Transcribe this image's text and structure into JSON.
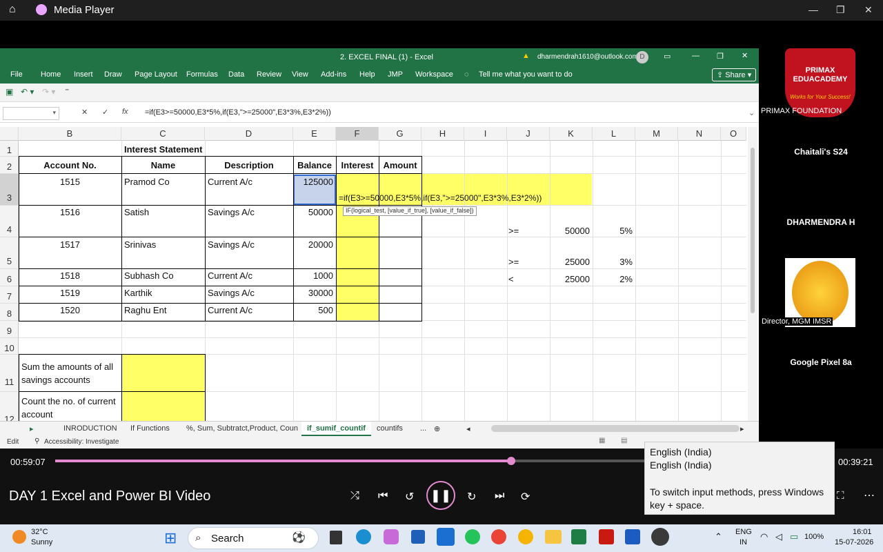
{
  "player": {
    "title": "Media Player",
    "video_title": "DAY 1 Excel and Power BI  Video",
    "time_elapsed": "00:59:07",
    "time_remaining": "00:39:21",
    "progress": 0.585
  },
  "excel": {
    "window_title": "2. EXCEL FINAL (1) - Excel",
    "account": "dharmendrah1610@outlook.com",
    "avatar_letter": "D",
    "share_label": "Share",
    "menu": [
      "File",
      "Home",
      "Insert",
      "Draw",
      "Page Layout",
      "Formulas",
      "Data",
      "Review",
      "View",
      "Add-ins",
      "Help",
      "JMP",
      "Workspace"
    ],
    "tell_me": "Tell me what you want to do",
    "formula_bar": "=if(E3>=50000,E3*5%,if(E3,\">=25000\",E3*3%,E3*2%))",
    "fx_label": "fx",
    "columns": [
      "B",
      "C",
      "D",
      "E",
      "F",
      "G",
      "H",
      "I",
      "J",
      "K",
      "L",
      "M",
      "N",
      "O"
    ],
    "rows": [
      "1",
      "2",
      "3",
      "4",
      "5",
      "6",
      "7",
      "8",
      "9",
      "10",
      "11",
      "12"
    ],
    "sheet_title": "Interest Statement",
    "headers": {
      "account": "Account No.",
      "name": "Name",
      "desc": "Description",
      "balance": "Balance",
      "interest": "Interest",
      "amount": "Amount"
    },
    "records": [
      {
        "acc": "1515",
        "name": "Pramod Co",
        "desc": "Current A/c",
        "bal": "125000"
      },
      {
        "acc": "1516",
        "name": "Satish",
        "desc": "Savings A/c",
        "bal": "50000"
      },
      {
        "acc": "1517",
        "name": "Srinivas",
        "desc": "Savings A/c",
        "bal": "20000"
      },
      {
        "acc": "1518",
        "name": "Subhash Co",
        "desc": "Current A/c",
        "bal": "1000"
      },
      {
        "acc": "1519",
        "name": "Karthik",
        "desc": "Savings A/c",
        "bal": "30000"
      },
      {
        "acc": "1520",
        "name": "Raghu Ent",
        "desc": "Current A/c",
        "bal": "500"
      }
    ],
    "cell_formula": "=if(E3>=50000,E3*5%,if(E3,\">=25000\",E3*3%,E3*2%))",
    "tooltip": "IF(logical_test, [value_if_true], [value_if_false])",
    "criteria": [
      {
        "op": ">=",
        "val": "50000",
        "pct": "5%"
      },
      {
        "op": ">=",
        "val": "25000",
        "pct": "3%"
      },
      {
        "op": "<",
        "val": "25000",
        "pct": "2%"
      }
    ],
    "q1": "Sum the amounts of all savings accounts",
    "q2": "Count the no. of current account",
    "tabs": [
      "INRODUCTION",
      "If Functions",
      "%, Sum, Subtratct,Product, Coun",
      "if_sumif_countif",
      "countifs",
      "..."
    ],
    "status_mode": "Edit",
    "accessibility": "Accessibility: Investigate"
  },
  "side": {
    "org_logo_text": "PRIMAX EDUACADEMY",
    "org_tagline": "Works for Your Success!",
    "org": "PRIMAX FOUNDATION",
    "p1": "Chaitali's S24",
    "p2": "DHARMENDRA H",
    "p3": "Director, MGM IMSR",
    "p4": "Google Pixel 8a"
  },
  "popup": {
    "line1": "English (India)",
    "line2": "English (India)",
    "hint": "To switch input methods, press Windows key + space."
  },
  "taskbar": {
    "temp": "32°C",
    "weather": "Sunny",
    "search": "Search",
    "lang1": "ENG",
    "lang2": "IN",
    "battery": "100%",
    "time": "16:01",
    "date": "15-07-2026"
  }
}
